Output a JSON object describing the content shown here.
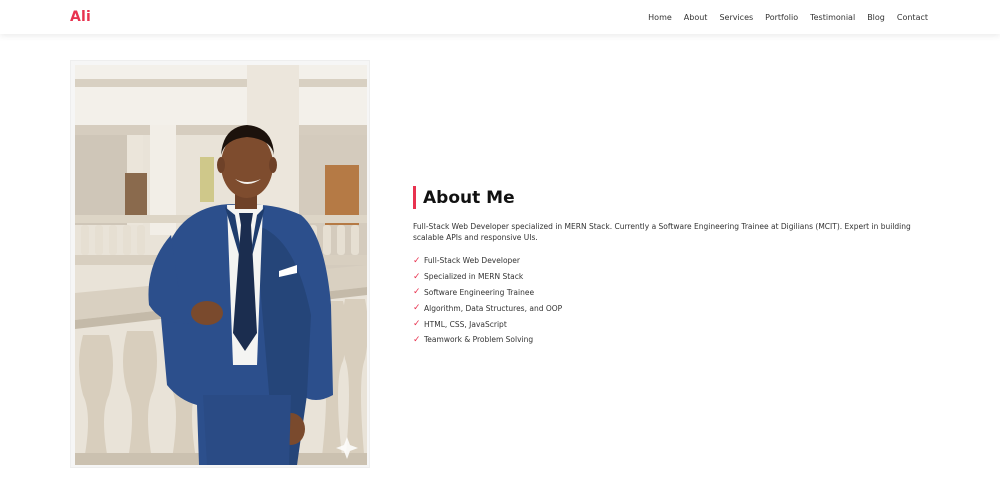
{
  "header": {
    "logo": "Ali",
    "nav": [
      {
        "label": "Home"
      },
      {
        "label": "About"
      },
      {
        "label": "Services"
      },
      {
        "label": "Portfolio"
      },
      {
        "label": "Testimonial"
      },
      {
        "label": "Blog"
      },
      {
        "label": "Contact"
      }
    ]
  },
  "about": {
    "title": "About Me",
    "description": "Full-Stack Web Developer specialized in MERN Stack. Currently a Software Engineering Trainee at Digilians (MCIT). Expert in building scalable APIs and responsive UIs.",
    "skills": [
      "Full-Stack Web Developer",
      "Specialized in MERN Stack",
      "Software Engineering Trainee",
      "Algorithm, Data Structures, and OOP",
      "HTML, CSS, JavaScript",
      "Teamwork & Problem Solving"
    ],
    "check_icon": "checkmark-icon"
  },
  "colors": {
    "accent": "#e8324f",
    "suit": "#2c4f8c"
  }
}
